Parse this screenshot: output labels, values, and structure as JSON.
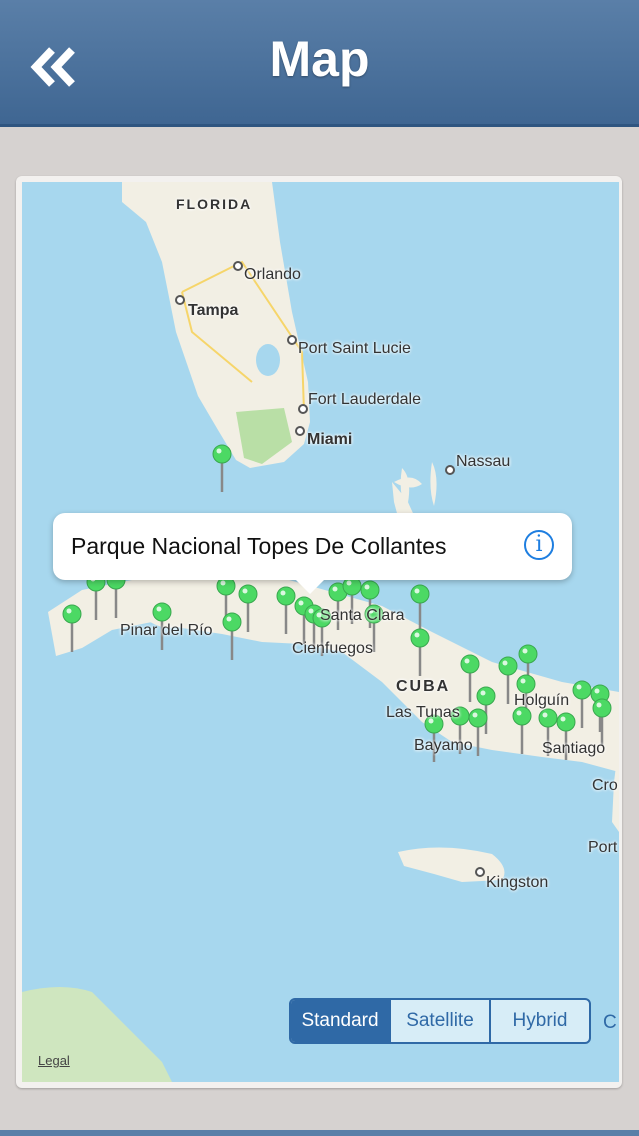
{
  "header": {
    "title": "Map",
    "back_icon": "double-chevron-left-icon"
  },
  "map": {
    "labels": {
      "florida": "FLORIDA",
      "orlando": "Orlando",
      "tampa": "Tampa",
      "port_saint_lucie": "Port Saint Lucie",
      "fort_lauderdale": "Fort Lauderdale",
      "miami": "Miami",
      "nassau": "Nassau",
      "pinar_del_rio": "Pinar del Río",
      "santa_clara": "Santa Clara",
      "cienfuegos": "Cienfuegos",
      "cuba": "CUBA",
      "las_tunas": "Las Tunas",
      "holguin": "Holguín",
      "bayamo": "Bayamo",
      "santiago": "Santiago",
      "cro": "Cro",
      "port": "Port",
      "kingston": "Kingston"
    },
    "pin_color": "#4cd964",
    "legal": "Legal"
  },
  "callout": {
    "title": "Parque Nacional Topes De Collantes",
    "info_icon": "info-icon"
  },
  "segmented": {
    "options": [
      "Standard",
      "Satellite",
      "Hybrid"
    ],
    "selected": "Standard"
  }
}
